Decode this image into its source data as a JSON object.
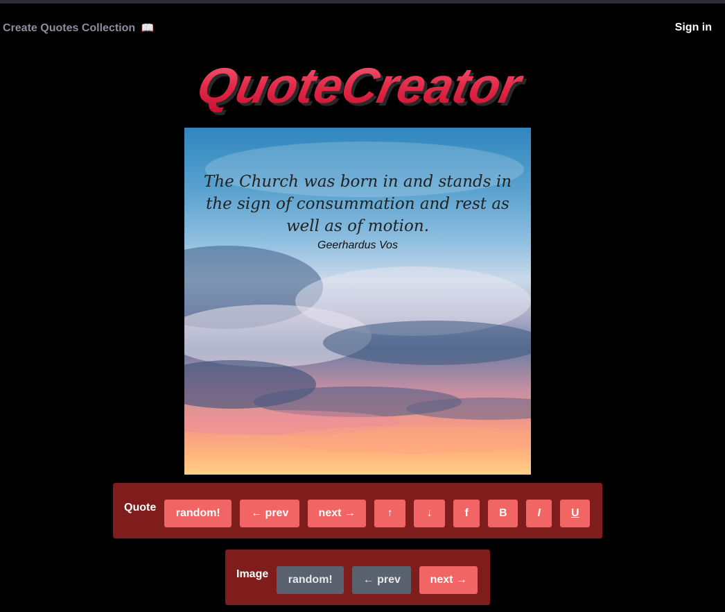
{
  "header": {
    "collection_link": "Create Quotes Collection",
    "collection_icon": "open-book-icon",
    "signin": "Sign in"
  },
  "logo": {
    "text": "QuoteCreator",
    "color": "#e8334f"
  },
  "quote": {
    "text": "The Church was born in and stands in the sign of consummation and rest as well as of motion.",
    "author": "Geerhardus Vos"
  },
  "quote_controls": {
    "label": "Quote",
    "random": "random!",
    "prev": "← prev",
    "next": "next →",
    "up": "↑",
    "down": "↓",
    "font": "f",
    "bold": "B",
    "italic": "I",
    "underline": "U"
  },
  "image_controls": {
    "label": "Image",
    "random": "random!",
    "prev": "← prev",
    "next": "next →"
  },
  "colors": {
    "panel": "#7f1d1d",
    "button": "#f26565",
    "button_disabled": "#5a6270"
  }
}
